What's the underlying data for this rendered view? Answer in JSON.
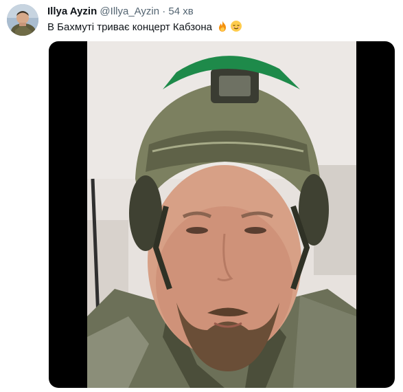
{
  "tweet": {
    "author_name": "Illya Ayzin",
    "handle": "@Illya_Ayzin",
    "separator": "·",
    "time": "54 хв",
    "text": "В Бахмуті триває концерт Кабзона",
    "emojis": [
      "fire-emoji",
      "relieved-face-emoji"
    ]
  },
  "media": {
    "type": "video-frame",
    "subject": "soldier-selfie-helmet"
  }
}
